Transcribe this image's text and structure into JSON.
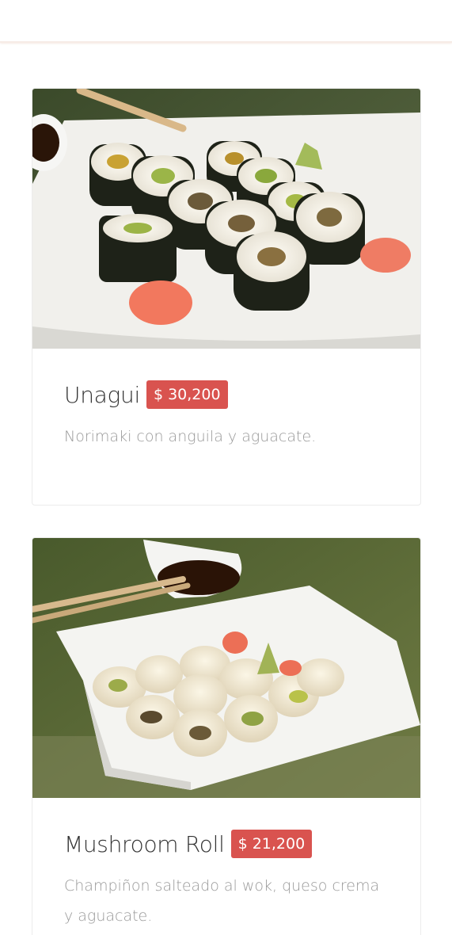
{
  "menu": {
    "items": [
      {
        "title": "Unagui",
        "price": "$ 30,200",
        "description": "Norimaki con anguila y aguacate.",
        "image": "unagui-sushi-photo"
      },
      {
        "title": "Mushroom Roll",
        "price": "$ 21,200",
        "description": "Champiñon salteado al wok, queso crema y aguacate.",
        "image": "mushroom-roll-photo"
      }
    ]
  },
  "colors": {
    "price_badge": "#d9534f",
    "title_text": "#333333",
    "description_text": "#999999"
  }
}
